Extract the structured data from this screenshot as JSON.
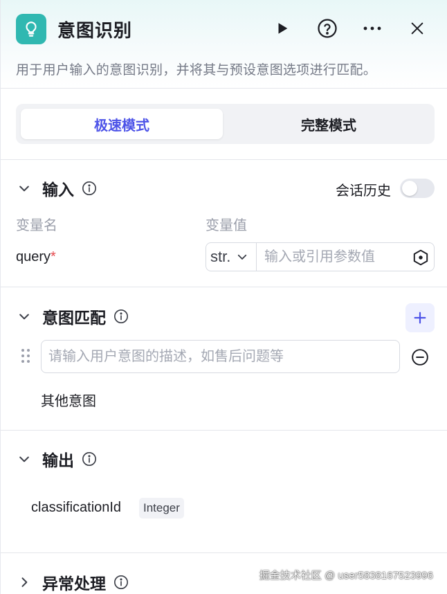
{
  "header": {
    "title": "意图识别",
    "description": "用于用户输入的意图识别，并将其与预设意图选项进行匹配。",
    "icon": "lightbulb-icon",
    "accent_color": "#30b8b1"
  },
  "mode_tabs": [
    {
      "label": "极速模式",
      "active": true
    },
    {
      "label": "完整模式",
      "active": false
    }
  ],
  "input_section": {
    "title": "输入",
    "history_label": "会话历史",
    "history_enabled": false,
    "col_name_header": "变量名",
    "col_value_header": "变量值",
    "variable": {
      "name": "query",
      "required_mark": "*",
      "type": "str.",
      "value_placeholder": "输入或引用参数值"
    }
  },
  "intent_section": {
    "title": "意图匹配",
    "intent_placeholder": "请输入用户意图的描述，如售后问题等",
    "other_intent": "其他意图"
  },
  "output_section": {
    "title": "输出",
    "field_name": "classificationId",
    "field_type": "Integer"
  },
  "error_section": {
    "title": "异常处理"
  },
  "watermark": "掘金技术社区 @ user5838167523996",
  "colors": {
    "primary": "#4d53e8",
    "required": "#e5484d"
  }
}
